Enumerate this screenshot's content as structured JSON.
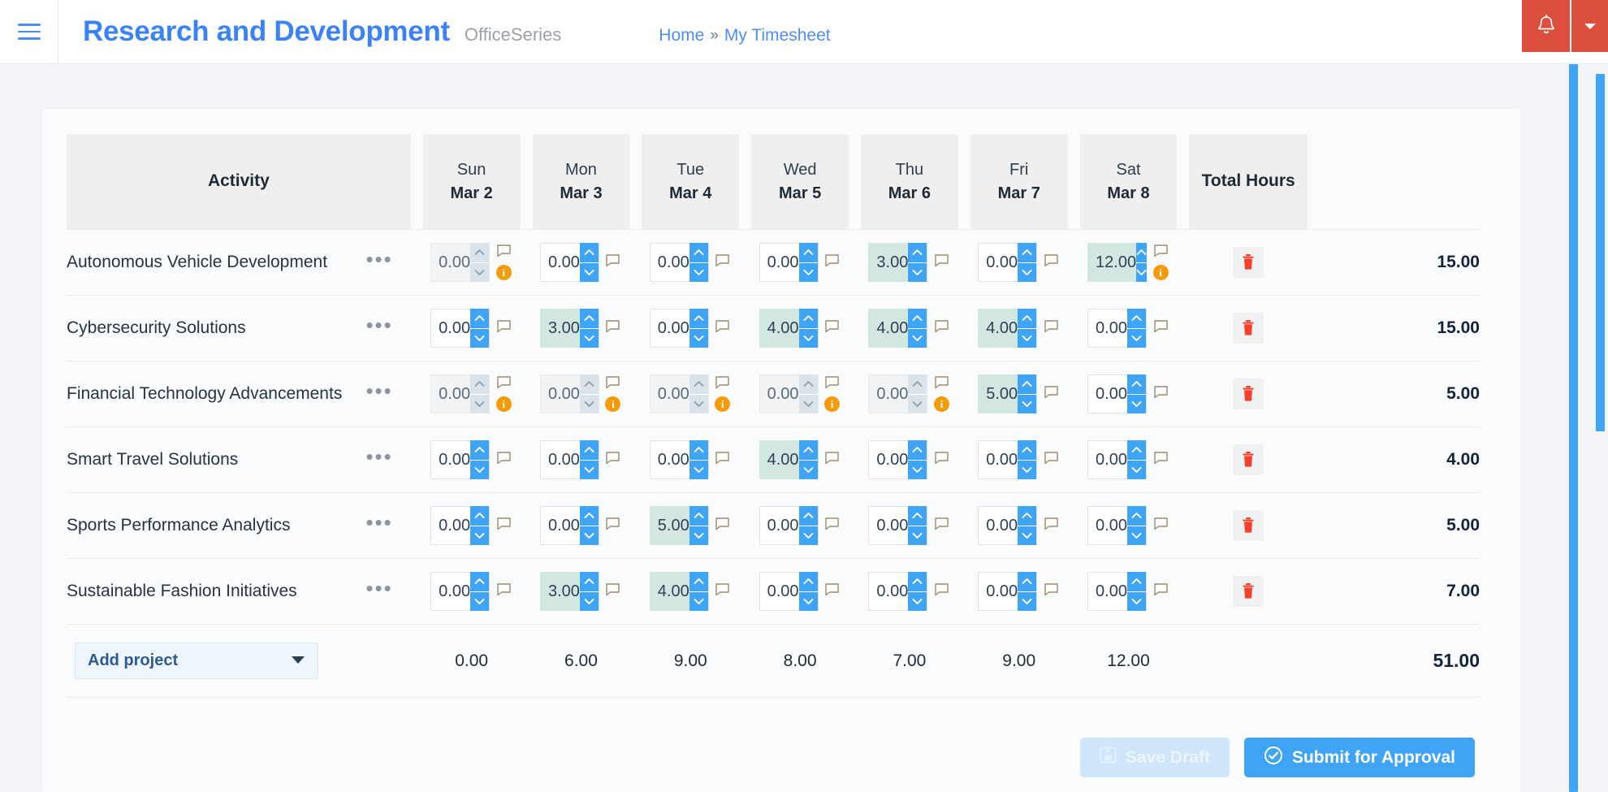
{
  "header": {
    "menu_icon": "hamburger-icon",
    "title": "Research and Development",
    "subtitle": "OfficeSeries",
    "breadcrumb": {
      "home": "Home",
      "separator": "»",
      "current": "My Timesheet"
    },
    "notification_icon": "bell-icon",
    "dropdown_icon": "caret-down-icon",
    "accent_color": "#3b82f6",
    "alert_color": "#dc4e3e"
  },
  "table": {
    "activity_header": "Activity",
    "total_header": "Total Hours",
    "days": [
      {
        "dow": "Sun",
        "date": "Mar 2"
      },
      {
        "dow": "Mon",
        "date": "Mar 3"
      },
      {
        "dow": "Tue",
        "date": "Mar 4"
      },
      {
        "dow": "Wed",
        "date": "Mar 5"
      },
      {
        "dow": "Thu",
        "date": "Mar 6"
      },
      {
        "dow": "Fri",
        "date": "Mar 7"
      },
      {
        "dow": "Sat",
        "date": "Mar 8"
      }
    ],
    "rows": [
      {
        "activity": "Autonomous Vehicle Development",
        "total": "15.00",
        "cells": [
          {
            "value": "0.00",
            "state": "disabled",
            "info": true
          },
          {
            "value": "0.00",
            "state": "empty",
            "info": false
          },
          {
            "value": "0.00",
            "state": "empty",
            "info": false
          },
          {
            "value": "0.00",
            "state": "empty",
            "info": false
          },
          {
            "value": "3.00",
            "state": "filled",
            "info": false
          },
          {
            "value": "0.00",
            "state": "empty",
            "info": false
          },
          {
            "value": "12.00",
            "state": "filled",
            "info": true
          }
        ]
      },
      {
        "activity": "Cybersecurity Solutions",
        "total": "15.00",
        "cells": [
          {
            "value": "0.00",
            "state": "empty",
            "info": false
          },
          {
            "value": "3.00",
            "state": "filled",
            "info": false
          },
          {
            "value": "0.00",
            "state": "empty",
            "info": false
          },
          {
            "value": "4.00",
            "state": "filled",
            "info": false
          },
          {
            "value": "4.00",
            "state": "filled",
            "info": false
          },
          {
            "value": "4.00",
            "state": "filled",
            "info": false
          },
          {
            "value": "0.00",
            "state": "empty",
            "info": false
          }
        ]
      },
      {
        "activity": "Financial Technology Advancements",
        "total": "5.00",
        "cells": [
          {
            "value": "0.00",
            "state": "disabled",
            "info": true
          },
          {
            "value": "0.00",
            "state": "disabled",
            "info": true
          },
          {
            "value": "0.00",
            "state": "disabled",
            "info": true
          },
          {
            "value": "0.00",
            "state": "disabled",
            "info": true
          },
          {
            "value": "0.00",
            "state": "disabled",
            "info": true
          },
          {
            "value": "5.00",
            "state": "filled",
            "info": false
          },
          {
            "value": "0.00",
            "state": "empty",
            "info": false
          }
        ]
      },
      {
        "activity": "Smart Travel Solutions",
        "total": "4.00",
        "cells": [
          {
            "value": "0.00",
            "state": "empty",
            "info": false
          },
          {
            "value": "0.00",
            "state": "empty",
            "info": false
          },
          {
            "value": "0.00",
            "state": "empty",
            "info": false
          },
          {
            "value": "4.00",
            "state": "filled",
            "info": false
          },
          {
            "value": "0.00",
            "state": "empty",
            "info": false
          },
          {
            "value": "0.00",
            "state": "empty",
            "info": false
          },
          {
            "value": "0.00",
            "state": "empty",
            "info": false
          }
        ]
      },
      {
        "activity": "Sports Performance Analytics",
        "total": "5.00",
        "cells": [
          {
            "value": "0.00",
            "state": "empty",
            "info": false
          },
          {
            "value": "0.00",
            "state": "empty",
            "info": false
          },
          {
            "value": "5.00",
            "state": "filled",
            "info": false
          },
          {
            "value": "0.00",
            "state": "empty",
            "info": false
          },
          {
            "value": "0.00",
            "state": "empty",
            "info": false
          },
          {
            "value": "0.00",
            "state": "empty",
            "info": false
          },
          {
            "value": "0.00",
            "state": "empty",
            "info": false
          }
        ]
      },
      {
        "activity": "Sustainable Fashion Initiatives",
        "total": "7.00",
        "cells": [
          {
            "value": "0.00",
            "state": "empty",
            "info": false
          },
          {
            "value": "3.00",
            "state": "filled",
            "info": false
          },
          {
            "value": "4.00",
            "state": "filled",
            "info": false
          },
          {
            "value": "0.00",
            "state": "empty",
            "info": false
          },
          {
            "value": "0.00",
            "state": "empty",
            "info": false
          },
          {
            "value": "0.00",
            "state": "empty",
            "info": false
          },
          {
            "value": "0.00",
            "state": "empty",
            "info": false
          }
        ]
      }
    ],
    "footer": {
      "add_project_label": "Add project",
      "add_project_icon": "caret-down-icon",
      "day_totals": [
        "0.00",
        "6.00",
        "9.00",
        "8.00",
        "7.00",
        "9.00",
        "12.00"
      ],
      "grand_total": "51.00"
    },
    "row_menu_icon": "ellipsis-icon",
    "delete_icon": "trash-icon",
    "note_icon": "comment-icon",
    "info_icon": "info-badge-icon",
    "info_badge_char": "i",
    "filled_cell_color": "#d3e7e2",
    "spinner_color": "#3fa3f6",
    "info_color": "#f59b0b",
    "delete_color": "#f5402c"
  },
  "actions": {
    "save_draft_label": "Save Draft",
    "save_draft_icon": "save-disk-icon",
    "submit_label": "Submit for Approval",
    "submit_icon": "check-circle-icon"
  },
  "scrollbars": {
    "color": "#3fa3f6"
  }
}
